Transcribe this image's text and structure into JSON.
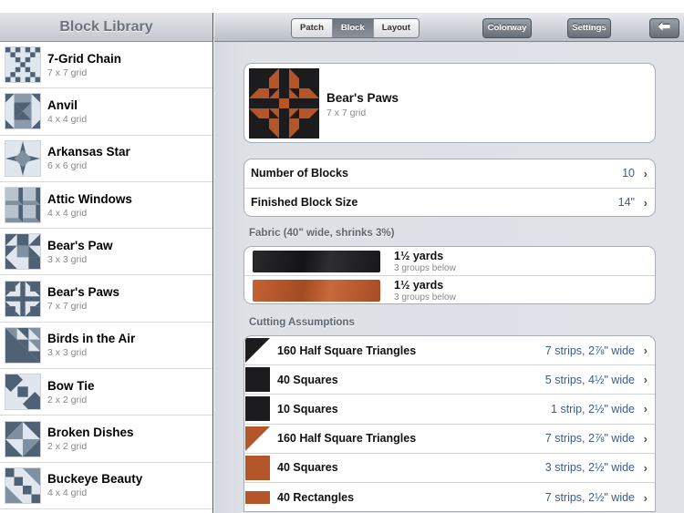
{
  "sidebar": {
    "title": "Block Library",
    "items": [
      {
        "title": "7-Grid Chain",
        "grid": "7 x 7 grid",
        "icon": "7-grid-chain-thumbnail"
      },
      {
        "title": "Anvil",
        "grid": "4 x 4 grid",
        "icon": "anvil-thumbnail"
      },
      {
        "title": "Arkansas Star",
        "grid": "6 x 6 grid",
        "icon": "arkansas-star-thumbnail"
      },
      {
        "title": "Attic Windows",
        "grid": "4 x 4 grid",
        "icon": "attic-windows-thumbnail"
      },
      {
        "title": "Bear's Paw",
        "grid": "3 x 3 grid",
        "icon": "bears-paw-thumbnail"
      },
      {
        "title": "Bear's Paws",
        "grid": "7 x 7 grid",
        "icon": "bears-paws-thumbnail"
      },
      {
        "title": "Birds in the Air",
        "grid": "3 x 3 grid",
        "icon": "birds-in-the-air-thumbnail"
      },
      {
        "title": "Bow Tie",
        "grid": "2 x 2 grid",
        "icon": "bow-tie-thumbnail"
      },
      {
        "title": "Broken Dishes",
        "grid": "2 x 2 grid",
        "icon": "broken-dishes-thumbnail"
      },
      {
        "title": "Buckeye Beauty",
        "grid": "4 x 4 grid",
        "icon": "buckeye-beauty-thumbnail"
      }
    ]
  },
  "toolbar": {
    "segments": [
      "Patch",
      "Block",
      "Layout"
    ],
    "active_segment": "Block",
    "colorway_label": "Colorway",
    "settings_label": "Settings",
    "back_icon": "back-arrow-icon"
  },
  "block": {
    "name": "Bear's Paws",
    "grid": "7 x 7 grid"
  },
  "settings": {
    "number_label": "Number of Blocks",
    "number_value": "10",
    "size_label": "Finished Block Size",
    "size_value": "14\""
  },
  "fabric": {
    "title": "Fabric (40\" wide, shrinks 3%)",
    "items": [
      {
        "yards": "1½ yards",
        "groups": "3 groups below",
        "color": "#1c1c1e"
      },
      {
        "yards": "1½ yards",
        "groups": "3 groups below",
        "color": "#b4562a"
      }
    ]
  },
  "cutting": {
    "title": "Cutting Assumptions",
    "items": [
      {
        "label": "160 Half Square Triangles",
        "value": "7 strips, 2⅞\" wide",
        "fabric": "dark",
        "shape": "triangle"
      },
      {
        "label": "40 Squares",
        "value": "5 strips, 4½\" wide",
        "fabric": "dark",
        "shape": "square"
      },
      {
        "label": "10 Squares",
        "value": "1 strip, 2½\" wide",
        "fabric": "dark",
        "shape": "square"
      },
      {
        "label": "160 Half Square Triangles",
        "value": "7 strips, 2⅞\" wide",
        "fabric": "rust",
        "shape": "triangle"
      },
      {
        "label": "40 Squares",
        "value": "3 strips, 2½\" wide",
        "fabric": "rust",
        "shape": "square"
      },
      {
        "label": "40 Rectangles",
        "value": "7 strips, 2½\" wide",
        "fabric": "rust",
        "shape": "rectangle"
      }
    ]
  },
  "colors": {
    "dark_fabric": "#1c1c1e",
    "rust_fabric": "#b4562a",
    "value_blue": "#3a5b92",
    "thumb_light": "#dfe6ee",
    "thumb_dark": "#4f6275"
  }
}
